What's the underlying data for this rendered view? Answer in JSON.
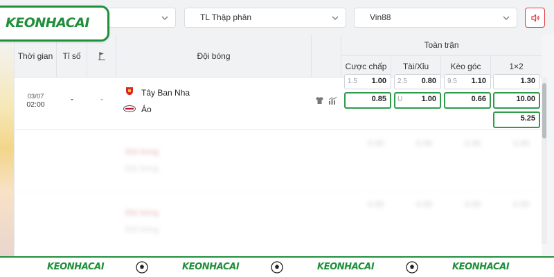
{
  "brand": {
    "logo_text": "KEONHACAI"
  },
  "filters": {
    "first_value": "",
    "odds_format": "TL Thập phân",
    "bookmaker": "Vin88"
  },
  "header": {
    "col_time": "Thời gian",
    "col_score": "Tỉ số",
    "col_corner_icon": "corner-flag-icon",
    "col_teams": "Đội bóng",
    "full_match": "Toàn trận",
    "col_handicap": "Cược chấp",
    "col_over_under": "Tài/Xỉu",
    "col_corner": "Kèo góc",
    "col_1x2": "1×2"
  },
  "match": {
    "date": "03/07",
    "time": "02:00",
    "score": "-",
    "corner_score": "-",
    "home_team": "Tây Ban Nha",
    "away_team": "Áo",
    "handicap": {
      "line": "1.5",
      "home": "1.00",
      "away": "0.85"
    },
    "over_under": {
      "line": "2.5",
      "over": "0.80",
      "under_label": "U",
      "under": "1.00"
    },
    "corner": {
      "line": "9.5",
      "over": "1.10",
      "under": "0.66"
    },
    "one_x_two": {
      "home": "1.30",
      "away": "10.00",
      "draw": "5.25"
    }
  },
  "blurred_rows": [
    {
      "home": "Đội bóng",
      "away": "Đội bóng",
      "odds": [
        "0.00",
        "0.00",
        "0.00",
        "0.00"
      ]
    },
    {
      "home": "Đội bóng",
      "away": "Đội bóng",
      "odds": [
        "0.00",
        "0.00",
        "0.00",
        "0.00"
      ]
    }
  ],
  "footer": {
    "logo_text": "KEONHACAI"
  },
  "colors": {
    "brand_green": "#1f8f3a",
    "accent_red": "#e23b3b",
    "active_border": "#2e9b4a",
    "score_red": "#e23b3b",
    "corner_orange": "#f0a33a"
  }
}
